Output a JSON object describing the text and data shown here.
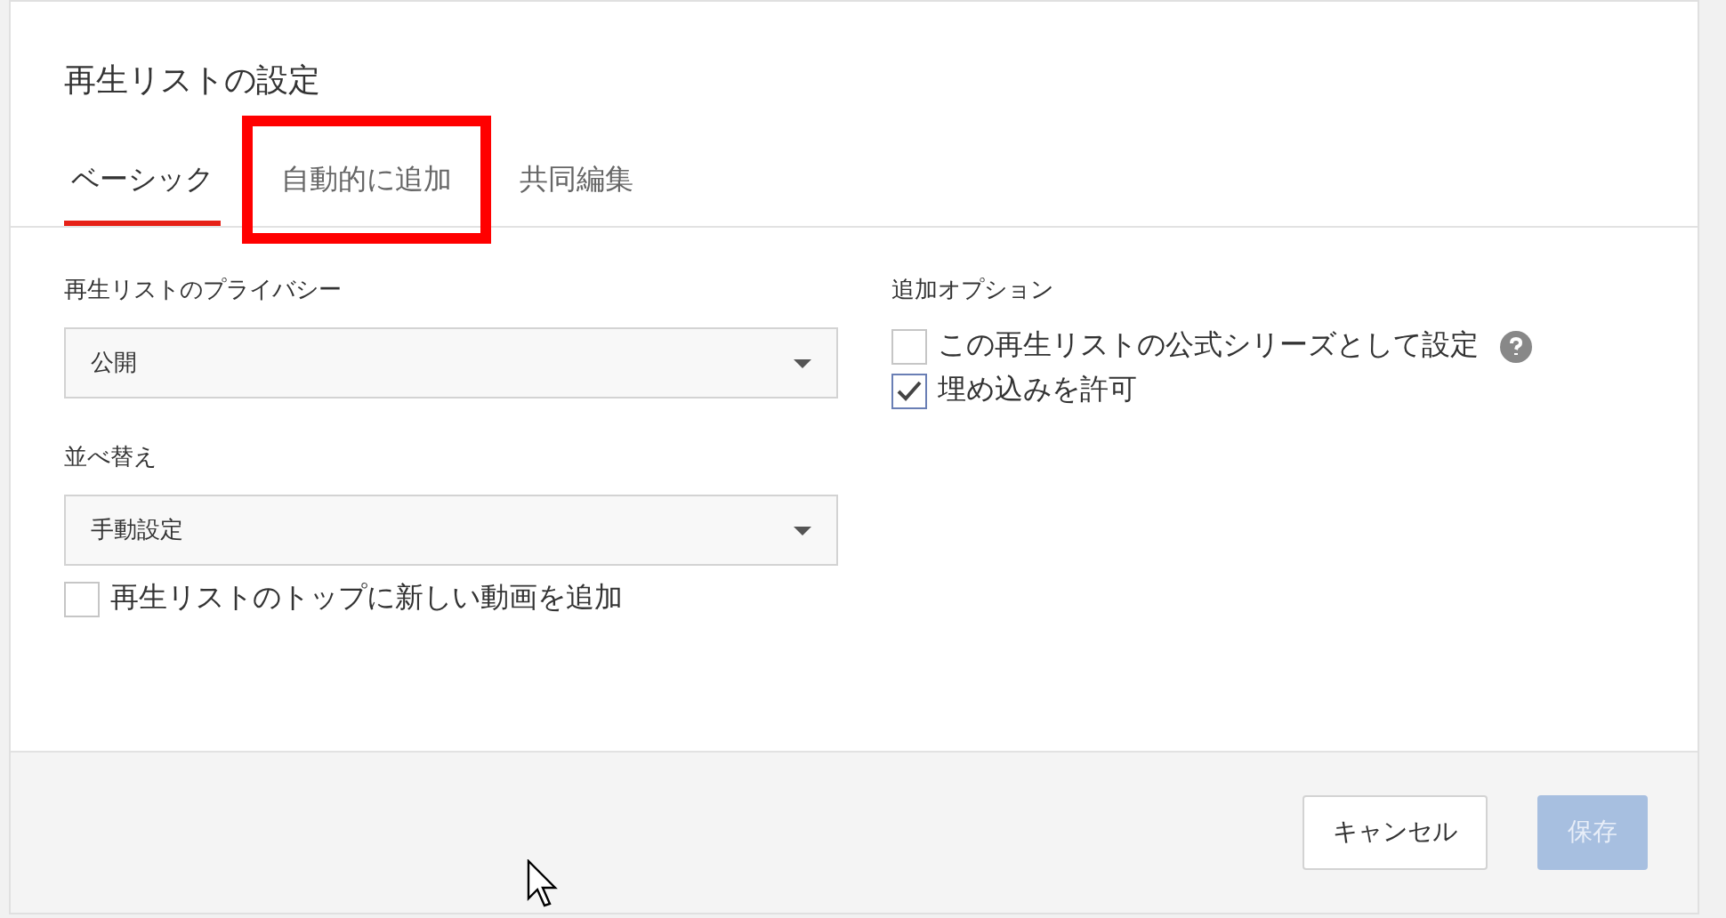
{
  "dialog": {
    "title": "再生リストの設定"
  },
  "tabs": [
    {
      "label": "ベーシック",
      "selected": true,
      "highlighted": false
    },
    {
      "label": "自動的に追加",
      "selected": false,
      "highlighted": true
    },
    {
      "label": "共同編集",
      "selected": false,
      "highlighted": false
    }
  ],
  "left": {
    "privacy": {
      "label": "再生リストのプライバシー",
      "value": "公開"
    },
    "order": {
      "label": "並べ替え",
      "value": "手動設定"
    },
    "add_to_top": {
      "label": "再生リストのトップに新しい動画を追加",
      "checked": false
    }
  },
  "right": {
    "heading": "追加オプション",
    "options": [
      {
        "label": "この再生リストの公式シリーズとして設定",
        "checked": false,
        "help": true
      },
      {
        "label": "埋め込みを許可",
        "checked": true,
        "help": false
      }
    ]
  },
  "buttons": [
    {
      "label": "キャンセル",
      "kind": "secondary",
      "disabled": false
    },
    {
      "label": "保存",
      "kind": "primary",
      "disabled": true
    }
  ]
}
